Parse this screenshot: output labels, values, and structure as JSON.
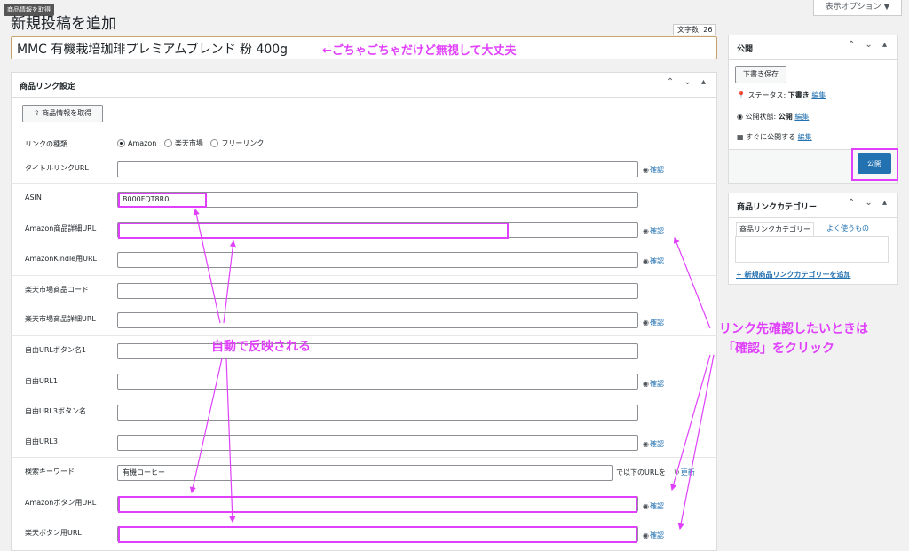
{
  "tooltip": "商品情報を取得",
  "page_title": "新規投稿を追加",
  "screen_options": "表示オプション ▼",
  "char_count": "文字数: 26",
  "title_value": "MMC 有機栽培珈琲プレミアムブレンド 粉 400g",
  "annotations": {
    "title_note": "←ごちゃごちゃだけど無視して大丈夫",
    "auto_reflect": "自動で反映される",
    "confirm_note_line1": "リンク先確認したいときは",
    "confirm_note_line2": "「確認」をクリック"
  },
  "product_link_panel": {
    "title": "商品リンク設定",
    "controls": "⌃⌄▴",
    "fetch_button": "商品情報を取得",
    "link_type_label": "リンクの種類",
    "link_types": [
      "Amazon",
      "楽天市場",
      "フリーリンク"
    ],
    "selected_link_type": "Amazon",
    "confirm_label": "確認",
    "rows": [
      {
        "label": "タイトルリンクURL",
        "value": ""
      },
      {
        "label": "ASIN",
        "value": "B000FQT8R0"
      },
      {
        "label": "Amazon商品詳細URL",
        "value": ""
      },
      {
        "label": "AmazonKindle用URL",
        "value": ""
      },
      {
        "label": "楽天市場商品コード",
        "value": ""
      },
      {
        "label": "楽天市場商品詳細URL",
        "value": ""
      },
      {
        "label": "自由URLボタン名1",
        "value": ""
      },
      {
        "label": "自由URL1",
        "value": ""
      },
      {
        "label": "自由URL3ボタン名",
        "value": ""
      },
      {
        "label": "自由URL3",
        "value": ""
      },
      {
        "label": "検索キーワード",
        "value": "有機コーヒー"
      },
      {
        "label": "Amazonボタン用URL",
        "value": ""
      },
      {
        "label": "楽天ボタン用URL",
        "value": ""
      }
    ],
    "search_suffix": "で以下のURLを",
    "refresh_label": "更新"
  },
  "publish_panel": {
    "title": "公開",
    "save_draft": "下書き保存",
    "status_label": "ステータス:",
    "status_value": "下書き",
    "visibility_label": "公開状態:",
    "visibility_value": "公開",
    "schedule_label": "すぐに公開する",
    "edit_label": "編集",
    "publish_button": "公開"
  },
  "category_panel": {
    "title": "商品リンクカテゴリー",
    "tab_all": "商品リンクカテゴリー",
    "tab_popular": "よく使うもの",
    "add_new": "+ 新規商品リンクカテゴリーを追加"
  },
  "colors": {
    "accent": "#2271b1",
    "annotation": "#e040fb"
  }
}
